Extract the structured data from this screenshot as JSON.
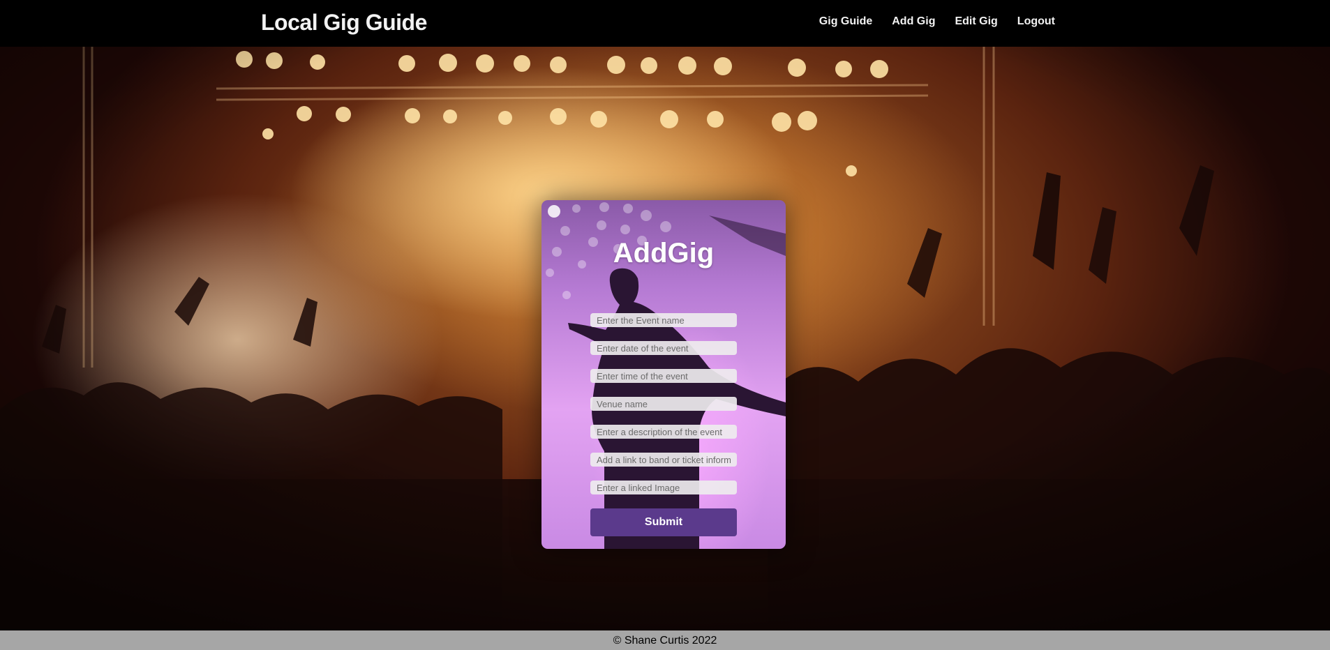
{
  "navbar": {
    "brand": "Local Gig Guide",
    "links": [
      "Gig Guide",
      "Add Gig",
      "Edit Gig",
      "Logout"
    ]
  },
  "form": {
    "title": "AddGig",
    "placeholders": {
      "event_name": "Enter the Event name",
      "date": "Enter date of the event",
      "time": "Enter time of the event",
      "venue": "Venue name",
      "description": "Enter a description of the event",
      "link": "Add a link to band or ticket information",
      "image": "Enter a linked Image"
    },
    "submit_label": "Submit"
  },
  "footer": {
    "text": "© Shane Curtis 2022"
  },
  "colors": {
    "navbar_bg": "#000000",
    "submit_bg": "#5b3a8c",
    "footer_bg": "#a6a6a6"
  }
}
